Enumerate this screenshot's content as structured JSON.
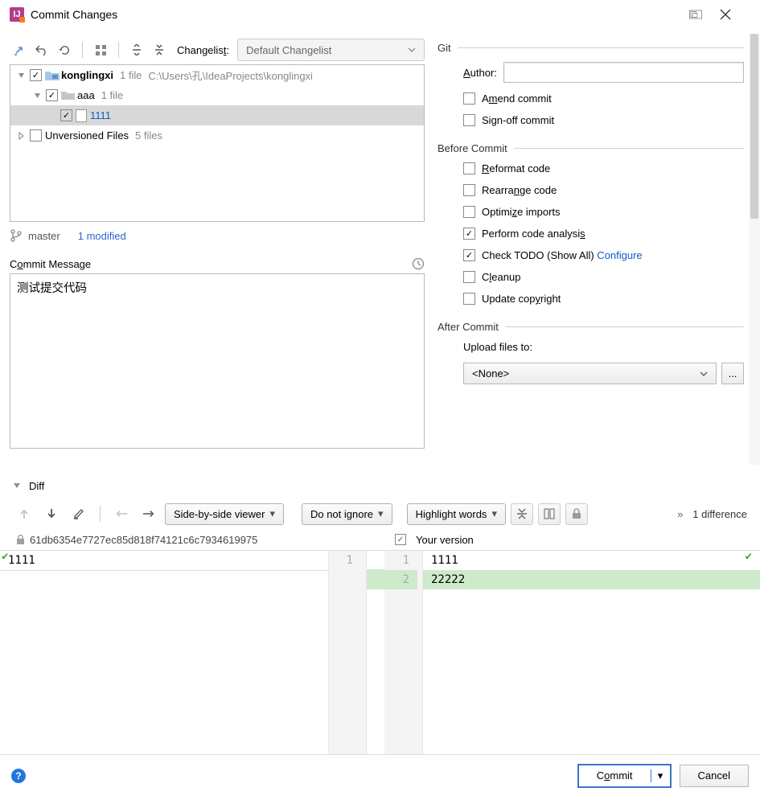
{
  "window": {
    "title": "Commit Changes"
  },
  "toolbar": {
    "changelist_label_pre": "Changelis",
    "changelist_label_u": "t",
    "changelist_label_post": ":",
    "changelist_value": "Default Changelist"
  },
  "tree": {
    "root": {
      "name": "konglingxi",
      "meta1": "1 file",
      "meta2": "C:\\Users\\孔\\IdeaProjects\\konglingxi",
      "checked": true
    },
    "folder": {
      "name": "aaa",
      "meta": "1 file",
      "checked": true
    },
    "file": {
      "name": "1111",
      "checked": true
    },
    "unversioned": {
      "label": "Unversioned Files",
      "meta": "5 files",
      "checked": false
    }
  },
  "status": {
    "branch": "master",
    "modified": "1 modified"
  },
  "commit_message": {
    "label_pre": "C",
    "label_u": "o",
    "label_post": "mmit Message",
    "value": "测试提交代码"
  },
  "git": {
    "section": "Git",
    "author_label_u": "A",
    "author_label": "uthor:",
    "author_value": "",
    "amend_pre": "A",
    "amend_u": "m",
    "amend_post": "end commit",
    "signoff_pre": "Si",
    "signoff_u": "g",
    "signoff_post": "n-off commit"
  },
  "before": {
    "section": "Before Commit",
    "reformat_u": "R",
    "reformat": "eformat code",
    "rearrange_pre": "Rearra",
    "rearrange_u": "n",
    "rearrange_post": "ge code",
    "optimize_pre": "Optimi",
    "optimize_u": "z",
    "optimize_post": "e imports",
    "analysis": "Perform code analysi",
    "analysis_u": "s",
    "todo": "Check TODO (Show All) ",
    "todo_link": "Configure",
    "cleanup_pre": "C",
    "cleanup_u": "l",
    "cleanup_post": "eanup",
    "copyright": "Update cop",
    "copyright_u": "y",
    "copyright_post": "right"
  },
  "after": {
    "section": "After Commit",
    "upload_label": "Upload files to:",
    "upload_value": "<None>",
    "browse": "..."
  },
  "diff": {
    "header": "Diff",
    "view_mode": "Side-by-side viewer",
    "ignore": "Do not ignore",
    "highlight": "Highlight words",
    "differences": "1 difference",
    "more": "»",
    "left_hash": "61db6354e7727ec85d818f74121c6c7934619975",
    "right_label": "Your version",
    "lines_left": {
      "n1": "1",
      "l1": "1111"
    },
    "lines_right": {
      "n1": "1",
      "n2": "2",
      "l1": "1111",
      "l2": "22222"
    }
  },
  "buttons": {
    "commit_pre": "C",
    "commit_u": "o",
    "commit_post": "mmit",
    "cancel": "Cancel"
  }
}
